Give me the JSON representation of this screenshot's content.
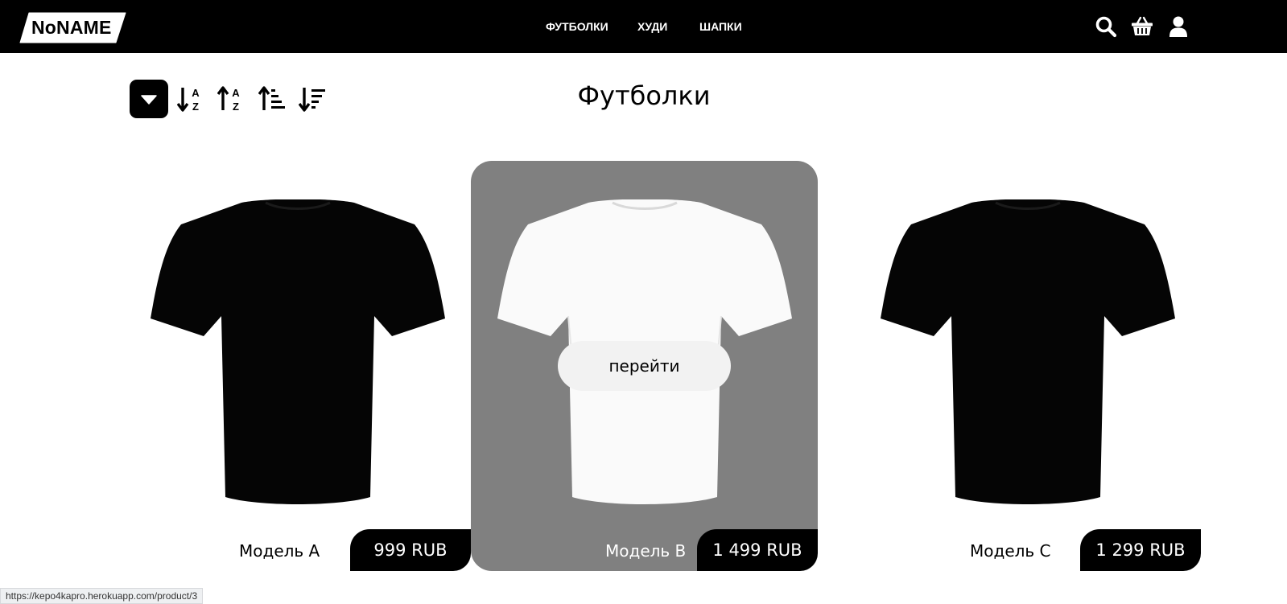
{
  "header": {
    "logo": "NoNAME",
    "nav": [
      "ФУТБОЛКИ",
      "ХУДИ",
      "ШАПКИ"
    ],
    "icons": [
      "search-icon",
      "basket-icon",
      "user-icon"
    ]
  },
  "sort_toolbar": {
    "icons": [
      "dropdown-caret-icon",
      "sort-alpha-down-icon",
      "sort-alpha-up-icon",
      "sort-amount-up-icon",
      "sort-amount-down-icon"
    ]
  },
  "page": {
    "title": "Футболки"
  },
  "products": [
    {
      "name": "Модель A",
      "price": "999 RUB",
      "shirt_color": "#000000"
    },
    {
      "name": "Модель B",
      "price": "1 499 RUB",
      "shirt_color": "#ffffff",
      "action_label": "перейти"
    },
    {
      "name": "Модель C",
      "price": "1 299 RUB",
      "shirt_color": "#000000"
    }
  ],
  "status_bar": {
    "url": "https://kepo4kapro.herokuapp.com/product/3"
  },
  "colors": {
    "header_bg": "#000000",
    "hover_card_bg": "#808080",
    "price_badge_bg": "#000000"
  }
}
